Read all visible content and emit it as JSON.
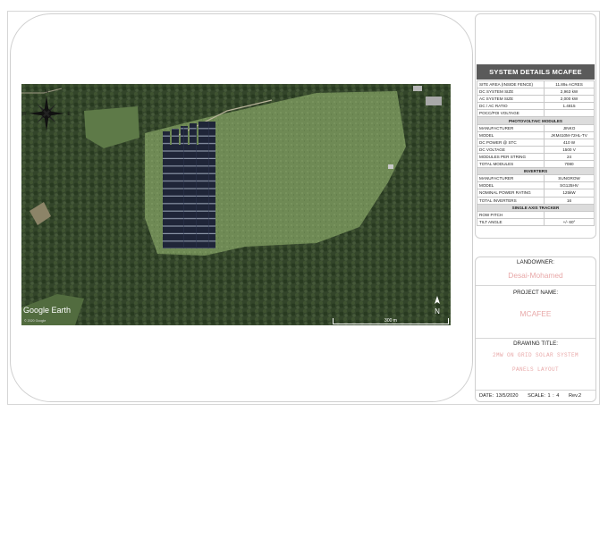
{
  "site_map": {
    "watermark": "Google Earth",
    "copyright": "© 2020 Google",
    "scale_bar": "300 m",
    "north_label": "N"
  },
  "system_details": {
    "title": "SYSTEM DETAILS MCAFEE",
    "rows": [
      {
        "label": "SITE AREA (INSIDE FENCE)",
        "value": "11.89± ACRES"
      },
      {
        "label": "DC SYSTEM SIZE",
        "value": "2,963 kW"
      },
      {
        "label": "AC SYSTEM SIZE",
        "value": "2,000 kW"
      },
      {
        "label": "DC / AC RATIO",
        "value": "1.4815"
      },
      {
        "label": "POCC/POI VOLTAGE",
        "value": ""
      }
    ],
    "sections": [
      {
        "title": "PHOTOVOLTAIC MODULES",
        "rows": [
          {
            "label": "MANUFACTURER",
            "value": "JINKO"
          },
          {
            "label": "MODEL",
            "value": "JKM410M-72HL-TV"
          },
          {
            "label": "DC POWER @ STC",
            "value": "410 W"
          },
          {
            "label": "DC VOLTAGE",
            "value": "1500 V"
          },
          {
            "label": "MODULES PER STRING",
            "value": "24"
          },
          {
            "label": "TOTAL MODULES",
            "value": "7080"
          }
        ]
      },
      {
        "title": "INVERTERS",
        "rows": [
          {
            "label": "MANUFACTURER",
            "value": "SUNGROW"
          },
          {
            "label": "MODEL",
            "value": "SG125HV"
          },
          {
            "label": "NOMINAL POWER RATING",
            "value": "125kW"
          },
          {
            "label": "TOTAL INVERTERS",
            "value": "16"
          }
        ]
      },
      {
        "title": "SINGLE AXIS TRACKER",
        "rows": [
          {
            "label": "ROW PITCH",
            "value": ""
          },
          {
            "label": "TILT ANGLE",
            "value": "+/- 60°"
          }
        ]
      }
    ]
  },
  "title_block": {
    "landowner_label": "LANDOWNER:",
    "landowner": "Desai-Mohamed",
    "project_label": "PROJECT NAME:",
    "project": "MCAFEE",
    "drawing_label": "DRAWING TITLE:",
    "drawing_line1": "2MW ON GRID  SOLAR SYSTEM",
    "drawing_line2": "PANELS LAYOUT",
    "date": "DATE: 13/5/2020",
    "scale": "SCALE:  1 : 4",
    "rev": "Rev.2"
  },
  "colors": {
    "header_bg": "#5a5a5a",
    "section_bg": "#dcdcdc",
    "pink_text": "#e8a8a8",
    "field": "#6f8a55",
    "forest": "#2f4124",
    "panels": "#1f2538"
  }
}
